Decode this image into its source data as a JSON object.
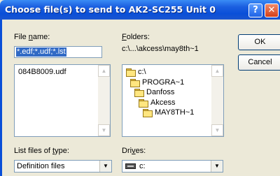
{
  "window": {
    "title": "Choose file(s) to send to AK2-SC255 Unit 0",
    "help_glyph": "?",
    "close_glyph": "✕"
  },
  "file_name": {
    "label_prefix": "File ",
    "label_mnemonic": "n",
    "label_suffix": "ame:",
    "value": "*.edf;*.udf;*.lst"
  },
  "files": {
    "items": [
      "084B8009.udf"
    ]
  },
  "folders": {
    "label_mnemonic": "F",
    "label_suffix": "olders:",
    "path": "c:\\...\\akcess\\may8th~1",
    "tree": [
      "c:\\",
      "PROGRA~1",
      "Danfoss",
      "Akcess",
      "MAY8TH~1"
    ]
  },
  "file_types": {
    "label_prefix": "List files of ",
    "label_mnemonic": "t",
    "label_suffix": "ype:",
    "value": "Definition files"
  },
  "drives": {
    "label_prefix": "Dri",
    "label_mnemonic": "v",
    "label_suffix": "es:",
    "value": "c:"
  },
  "buttons": {
    "ok": "OK",
    "cancel": "Cancel"
  },
  "glyphs": {
    "up": "▲",
    "down": "▼"
  }
}
